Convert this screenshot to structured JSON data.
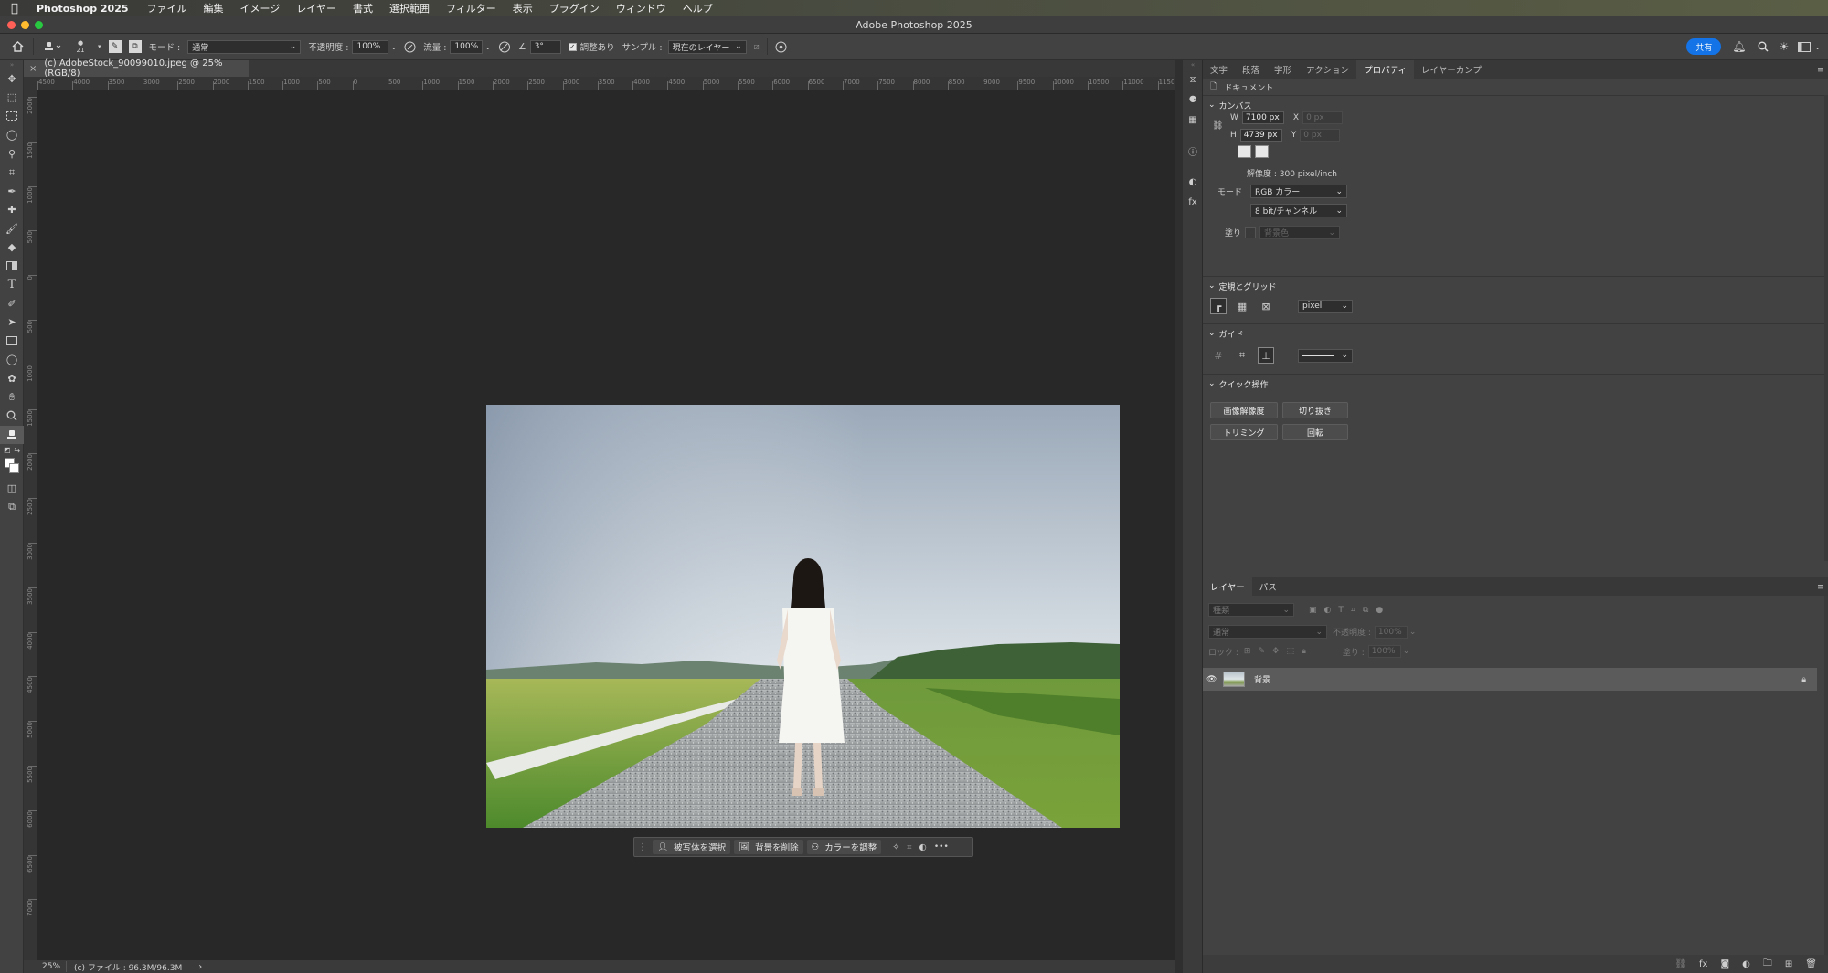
{
  "menubar": {
    "app_name": "Photoshop 2025",
    "items": [
      "ファイル",
      "編集",
      "イメージ",
      "レイヤー",
      "書式",
      "選択範囲",
      "フィルター",
      "表示",
      "プラグイン",
      "ウィンドウ",
      "ヘルプ"
    ]
  },
  "window": {
    "title": "Adobe Photoshop 2025"
  },
  "options": {
    "brush_size": "21",
    "mode_label": "モード :",
    "mode_value": "通常",
    "opacity_label": "不透明度 :",
    "opacity_value": "100%",
    "flow_label": "流量 :",
    "flow_value": "100%",
    "angle_value": "3°",
    "aligned_label": "調整あり",
    "sample_label": "サンプル :",
    "sample_value": "現在のレイヤー",
    "share_label": "共有"
  },
  "document": {
    "tab_label": "(c) AdobeStock_90099010.jpeg @ 25% (RGB/8)",
    "ruler_h": [
      "4500",
      "4000",
      "3500",
      "3000",
      "2500",
      "2000",
      "1500",
      "1000",
      "500",
      "0",
      "500",
      "1000",
      "1500",
      "2000",
      "2500",
      "3000",
      "3500",
      "4000",
      "4500",
      "5000",
      "5500",
      "6000",
      "6500",
      "7000",
      "7500",
      "8000",
      "8500",
      "9000",
      "9500",
      "10000",
      "10500",
      "11000",
      "1150"
    ],
    "ruler_v": [
      "2000",
      "1500",
      "1000",
      "500",
      "0",
      "500",
      "1000",
      "1500",
      "2000",
      "2500",
      "3000",
      "3500",
      "4000",
      "4500",
      "5000",
      "5500",
      "6000",
      "6500",
      "7000"
    ]
  },
  "context_bar": {
    "select_subject": "被写体を選択",
    "remove_bg": "背景を削除",
    "adjust_color": "カラーを調整",
    "more": "•••"
  },
  "status": {
    "zoom": "25%",
    "file_info": "(c) ファイル : 96.3M/96.3M"
  },
  "panel_tabs": [
    "文字",
    "段落",
    "字形",
    "アクション",
    "プロパティ",
    "レイヤーカンプ"
  ],
  "active_panel_tab": "プロパティ",
  "properties": {
    "doc_label": "ドキュメント",
    "canvas_title": "カンバス",
    "w_label": "W",
    "w_value": "7100 px",
    "h_label": "H",
    "h_value": "4739 px",
    "x_label": "X",
    "x_placeholder": "0 px",
    "y_label": "Y",
    "y_placeholder": "0 px",
    "resolution": "解像度 : 300 pixel/inch",
    "mode_label": "モード",
    "mode_value": "RGB カラー",
    "depth_value": "8 bit/チャンネル",
    "fill_label": "塗り",
    "fill_value": "背景色",
    "rulers_title": "定規とグリッド",
    "unit_value": "pixel",
    "guides_title": "ガイド",
    "quick_title": "クイック操作",
    "quick_buttons": [
      "画像解像度",
      "切り抜き",
      "トリミング",
      "回転"
    ]
  },
  "layers_panel": {
    "tabs": [
      "レイヤー",
      "パス"
    ],
    "filter_placeholder": "種類",
    "blend_value": "通常",
    "opacity_label": "不透明度 :",
    "opacity_value": "100%",
    "lock_label": "ロック :",
    "fill_label": "塗り :",
    "fill_value": "100%",
    "layers": [
      {
        "name": "背景",
        "visible": true,
        "locked": true
      }
    ]
  }
}
